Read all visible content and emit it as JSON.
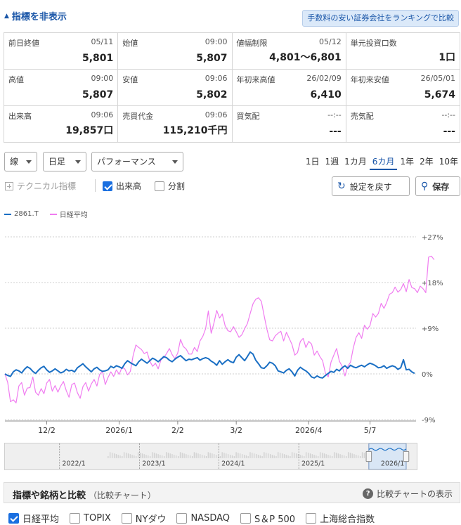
{
  "header": {
    "hide_indicators": "指標を非表示",
    "ranking_link": "手数料の安い証券会社をランキングで比較"
  },
  "stats": [
    [
      {
        "label": "前日終値",
        "time": "05/11",
        "value": "5,801"
      },
      {
        "label": "始値",
        "time": "09:00",
        "value": "5,807"
      },
      {
        "label": "値幅制限",
        "time": "05/12",
        "value": "4,801～6,801"
      },
      {
        "label": "単元投資口数",
        "time": "",
        "value": "1口"
      }
    ],
    [
      {
        "label": "高値",
        "time": "09:00",
        "value": "5,807"
      },
      {
        "label": "安値",
        "time": "09:06",
        "value": "5,802"
      },
      {
        "label": "年初来高値",
        "time": "26/02/09",
        "value": "6,410"
      },
      {
        "label": "年初来安値",
        "time": "26/05/01",
        "value": "5,674"
      }
    ],
    [
      {
        "label": "出来高",
        "time": "09:06",
        "value": "19,857口"
      },
      {
        "label": "売買代金",
        "time": "09:06",
        "value": "115,210千円"
      },
      {
        "label": "買気配",
        "time": "--:--",
        "value": "---"
      },
      {
        "label": "売気配",
        "time": "--:--",
        "value": "---"
      }
    ]
  ],
  "controls": {
    "chart_type": "線",
    "interval": "日足",
    "mode": "パフォーマンス",
    "periods": [
      "1日",
      "1週",
      "1カ月",
      "6カ月",
      "1年",
      "2年",
      "10年"
    ],
    "active_period": "6カ月",
    "technical": "テクニカル指標",
    "volume": "出来高",
    "split": "分割",
    "reset": "設定を戻す",
    "save": "保存"
  },
  "colors": {
    "primary": "#1a6fc4",
    "compare": "#f07cf0",
    "accent": "#1a56a8"
  },
  "chart_data": {
    "type": "line",
    "legend": [
      "2861.T",
      "日経平均"
    ],
    "y_ticks": [
      "+27%",
      "+18%",
      "+9%",
      "0%",
      "-9%"
    ],
    "y_tick_values": [
      27,
      18,
      9,
      0,
      -9
    ],
    "ylim": [
      -9,
      27
    ],
    "x_ticks": [
      "12/2",
      "2026/1",
      "2/2",
      "3/2",
      "2026/4",
      "5/7"
    ],
    "x_tick_index": [
      15,
      41,
      62,
      83,
      109,
      131
    ],
    "series": [
      {
        "name": "2861.T",
        "values": [
          0,
          -0.3,
          -0.5,
          0.4,
          0.8,
          0.6,
          0.2,
          0.9,
          1.4,
          1.1,
          0.5,
          0.1,
          0.7,
          1.2,
          1.5,
          0.8,
          0.3,
          0.6,
          1,
          0.6,
          0.2,
          0.4,
          0.9,
          0.6,
          0.7,
          0.4,
          1.2,
          1.6,
          2,
          1.4,
          0.9,
          0.4,
          1,
          1.3,
          0.8,
          0.5,
          0.6,
          0.8,
          1.5,
          1.2,
          1.6,
          1.4,
          1.1,
          2,
          2.6,
          2.2,
          1.9,
          1.6,
          2.4,
          2.9,
          2.5,
          2.1,
          2.6,
          3.1,
          2.8,
          2.4,
          2.9,
          3.4,
          3.2,
          2.7,
          2.4,
          2.9,
          3.3,
          3.6,
          3.1,
          2.6,
          2.9,
          2.8,
          3,
          3.2,
          2.7,
          3,
          3.2,
          3,
          2.5,
          2.2,
          1.7,
          2.6,
          1.9,
          2.4,
          2.8,
          2.4,
          2.2,
          3.3,
          3.8,
          3.2,
          2.6,
          3.4,
          4.3,
          3.9,
          2.7,
          2,
          1.2,
          1.1,
          1.6,
          2.3,
          2.1,
          1.6,
          0.6,
          0.4,
          0.2,
          0.7,
          1,
          0.4,
          -0.4,
          0.7,
          1.3,
          0.9,
          0.6,
          0.1,
          -0.6,
          -0.8,
          -0.4,
          -0.7,
          -0.8,
          -0.3,
          0.1,
          0.5,
          0.3,
          0.9,
          0.6,
          1.2,
          1.6,
          1.1,
          1.7,
          1.4,
          1.2,
          1.5,
          1.7,
          1.4,
          1.8,
          2.1,
          1.9,
          1.6,
          1.2,
          1.3,
          1.6,
          1.1,
          1.4,
          1.6,
          1.4,
          0.9,
          1.2,
          2.8,
          0.8,
          0.9,
          0.4,
          0.1
        ]
      },
      {
        "name": "日経平均",
        "values": [
          0,
          -1.7,
          -5.5,
          -5.1,
          -5.7,
          -2.4,
          -1.7,
          -4.2,
          -2.8,
          -2.7,
          -0.6,
          -3.6,
          -4.2,
          -2.9,
          -3.9,
          -1.8,
          -1.1,
          -3.4,
          -2.3,
          -3.6,
          -2.4,
          -1.5,
          -3.3,
          -4.6,
          -2.1,
          -1.8,
          -3.7,
          -4.8,
          -2.5,
          -1.7,
          -3.4,
          -2,
          -1.1,
          -2.4,
          -0.1,
          0.5,
          -2.1,
          -0.7,
          0.4,
          -0.5,
          0.8,
          -0.1,
          1.3,
          1,
          -0.2,
          0.5,
          3.6,
          5.7,
          5.2,
          4.8,
          4,
          4.3,
          2.5,
          1.5,
          2.1,
          1,
          2.8,
          3.2,
          4,
          5,
          3.8,
          3,
          4.1,
          6.8,
          5.4,
          4.9,
          3.9,
          3.9,
          5.2,
          4.4,
          6.5,
          7.4,
          8.9,
          12.4,
          8,
          10,
          12.5,
          11,
          11.8,
          9.5,
          8.5,
          8.3,
          9.3,
          8.3,
          7.2,
          7.7,
          8.9,
          9.9,
          11.9,
          13.8,
          14.7,
          15,
          14.3,
          11.5,
          8.8,
          6.7,
          6.5,
          7.5,
          8,
          8.4,
          6.5,
          8.2,
          7,
          5.8,
          3.7,
          4.2,
          6.4,
          7,
          5.2,
          6.4,
          5.9,
          3.7,
          4.5,
          3.4,
          2.6,
          0.1,
          -0.6,
          2.3,
          3.7,
          5,
          2.5,
          1.5,
          -0.4,
          1.5,
          2.3,
          5.1,
          7.2,
          8.1,
          7,
          9.6,
          8.8,
          9.5,
          11.9,
          11.2,
          11.9,
          13.9,
          12.9,
          14.1,
          15.7,
          16,
          17.1,
          16.1,
          16.6,
          17.8,
          16.2,
          18.6,
          17,
          16.8,
          16,
          17.3,
          16.8,
          16,
          23,
          23.2,
          22.5
        ]
      }
    ],
    "grid": true
  },
  "navigator": {
    "labels": [
      "2022/1",
      "2023/1",
      "2024/1",
      "2025/1",
      "2026/1"
    ]
  },
  "compare": {
    "title": "指標や銘柄と比較",
    "subtitle": "（比較チャート）",
    "help": "比較チャートの表示",
    "items": [
      {
        "label": "日経平均",
        "checked": true
      },
      {
        "label": "TOPIX",
        "checked": false
      },
      {
        "label": "NYダウ",
        "checked": false
      },
      {
        "label": "NASDAQ",
        "checked": false
      },
      {
        "label": "S＆P 500",
        "checked": false
      },
      {
        "label": "上海総合指数",
        "checked": false
      }
    ]
  }
}
